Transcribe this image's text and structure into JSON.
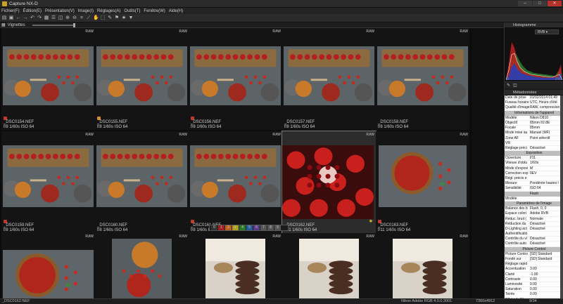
{
  "window": {
    "title": "Capture NX-D",
    "minimize": "–",
    "maximize": "□",
    "close": "✕"
  },
  "menu": [
    "Fichier(F)",
    "Édition(E)",
    "Présentation(V)",
    "Image(I)",
    "Réglages(A)",
    "Outils(T)",
    "Fenêtre(W)",
    "Aide(H)"
  ],
  "toolbar_icons": [
    "folder-icon",
    "save-icon",
    "back-icon",
    "forward-icon",
    "rotate-left-icon",
    "rotate-right-icon",
    "grid-icon",
    "list-icon",
    "compare-icon",
    "zoom-in-icon",
    "zoom-out-icon",
    "crop-icon",
    "straighten-icon",
    "hand-icon",
    "select-icon",
    "eyedropper-icon",
    "flag-icon",
    "star-icon",
    "filter-icon"
  ],
  "browser": {
    "label": "Vignettes"
  },
  "thumbnails": [
    {
      "name": "_DSC0154.NEF",
      "info": "f/8 1/60s ISO 64",
      "flag": "red",
      "selected": false,
      "starred": false,
      "image": "tart-board"
    },
    {
      "name": "_DSC0155.NEF",
      "info": "f/8 1/60s ISO 64",
      "flag": "orange",
      "selected": false,
      "starred": false,
      "image": "tart-board"
    },
    {
      "name": "_DSC0156.NEF",
      "info": "f/8 1/60s ISO 64",
      "flag": "red",
      "selected": false,
      "starred": false,
      "image": "tart-board"
    },
    {
      "name": "_DSC0157.NEF",
      "info": "f/8 1/60s ISO 64",
      "flag": "",
      "selected": false,
      "starred": false,
      "image": "tart-board"
    },
    {
      "name": "_DSC0158.NEF",
      "info": "f/8 1/60s ISO 64",
      "flag": "",
      "selected": false,
      "starred": false,
      "image": "tart-board"
    },
    {
      "name": "_DSC0159.NEF",
      "info": "f/8 1/60s ISO 64",
      "flag": "red",
      "selected": false,
      "starred": false,
      "image": "tart-board"
    },
    {
      "name": "_DSC0160.NEF",
      "info": "f/8 1/60s ISO 64",
      "flag": "",
      "selected": false,
      "starred": false,
      "image": "tart-board"
    },
    {
      "name": "_DSC0161.NEF",
      "info": "f/8 1/60s ISO 64",
      "flag": "red",
      "selected": false,
      "starred": false,
      "image": "tart-board"
    },
    {
      "name": "_DSC0162.NEF",
      "info": "f/11 1/60s ISO 64",
      "flag": "",
      "selected": true,
      "starred": true,
      "image": "strawberries"
    },
    {
      "name": "_DSC0163.NEF",
      "info": "f/11 1/60s ISO 64",
      "flag": "red",
      "selected": false,
      "starred": false,
      "image": "tart-round"
    },
    {
      "name": "",
      "info": "",
      "flag": "",
      "selected": false,
      "starred": false,
      "image": "tart-round"
    },
    {
      "name": "",
      "info": "",
      "flag": "",
      "selected": false,
      "starred": false,
      "image": "tart-top"
    },
    {
      "name": "",
      "info": "",
      "flag": "",
      "selected": false,
      "starred": false,
      "image": "cookies"
    },
    {
      "name": "",
      "info": "",
      "flag": "",
      "selected": false,
      "starred": false,
      "image": "cookies"
    },
    {
      "name": "",
      "info": "",
      "flag": "",
      "selected": false,
      "starred": false,
      "image": "cookies"
    }
  ],
  "label_popup": [
    "0",
    "1",
    "2",
    "3",
    "4",
    "5",
    "6",
    "7",
    "8",
    "9"
  ],
  "histogram": {
    "title": "Histogramme",
    "channel": "RVB",
    "min": "0",
    "max": "255"
  },
  "metadata": {
    "title": "Métadonnées",
    "rows": [
      {
        "k": "Date de prise",
        "v": "01/02/2014 01:49"
      },
      {
        "k": "Fuseau horaire",
        "v": "UTC, Heure d'été"
      },
      {
        "k": "Qualité d'image",
        "v": "RAW, compression"
      },
      {
        "section": "Informations de l'appareil"
      },
      {
        "k": "Modèle",
        "v": "Nikon D810"
      },
      {
        "k": "Objectif",
        "v": "85mm f/2.8E"
      },
      {
        "k": "Focale",
        "v": "85mm"
      },
      {
        "k": "Mode mise au",
        "v": "Manuel (MF)"
      },
      {
        "k": "Zone AF",
        "v": "Point sélectif"
      },
      {
        "k": "VR",
        "v": ""
      },
      {
        "k": "Réglage préci",
        "v": "Désactivé"
      },
      {
        "section": "Exposition"
      },
      {
        "k": "Ouverture",
        "v": "f/11"
      },
      {
        "k": "Vitesse d'obtu",
        "v": "1/60s"
      },
      {
        "k": "Mode d'exposi",
        "v": "M"
      },
      {
        "k": "Correction exp",
        "v": "0EV"
      },
      {
        "k": "Régl. précis e",
        "v": ""
      },
      {
        "k": "Mesure",
        "v": "Pondérée hautes l"
      },
      {
        "k": "Sensibilité",
        "v": "ISO 64"
      },
      {
        "section": "Flash"
      },
      {
        "k": "Modèle",
        "v": ""
      },
      {
        "section": "Paramètres de l'image"
      },
      {
        "k": "Balance des b",
        "v": "Flash, 0, 0"
      },
      {
        "k": "Espace colori",
        "v": "Adobe RVB"
      },
      {
        "k": "Réduc. bruit (",
        "v": "Normale"
      },
      {
        "k": "Réduction du",
        "v": "Désactivé"
      },
      {
        "k": "D-Lighting act",
        "v": "Désactivé"
      },
      {
        "k": "Authentificatio",
        "v": ""
      },
      {
        "k": "Contrôle du vi",
        "v": "Désactivé"
      },
      {
        "k": "Contrôle auto",
        "v": "Désactivé"
      },
      {
        "section": "Picture Control"
      },
      {
        "k": "Picture Contro",
        "v": "[SD] Standard"
      },
      {
        "k": "Fondé sur",
        "v": "[SD] Standard"
      },
      {
        "k": "Réglage rapid",
        "v": ""
      },
      {
        "k": "Accentuation",
        "v": "3.00"
      },
      {
        "k": "Clarté",
        "v": "-1.00"
      },
      {
        "k": "Contraste",
        "v": "0.00"
      },
      {
        "k": "Luminosité",
        "v": "0.00"
      },
      {
        "k": "Saturation",
        "v": "0.00"
      },
      {
        "k": "Teinte",
        "v": "0.00"
      },
      {
        "k": "Effets de filtre",
        "v": ""
      },
      {
        "k": "Virage",
        "v": ""
      },
      {
        "section": "Position"
      }
    ]
  },
  "status": {
    "file": "_DSC0162.NEF",
    "colorspace": "Nikon Adobe RGB 4.0.0.3001",
    "dimensions": "7360x4912",
    "count": "9/34"
  }
}
